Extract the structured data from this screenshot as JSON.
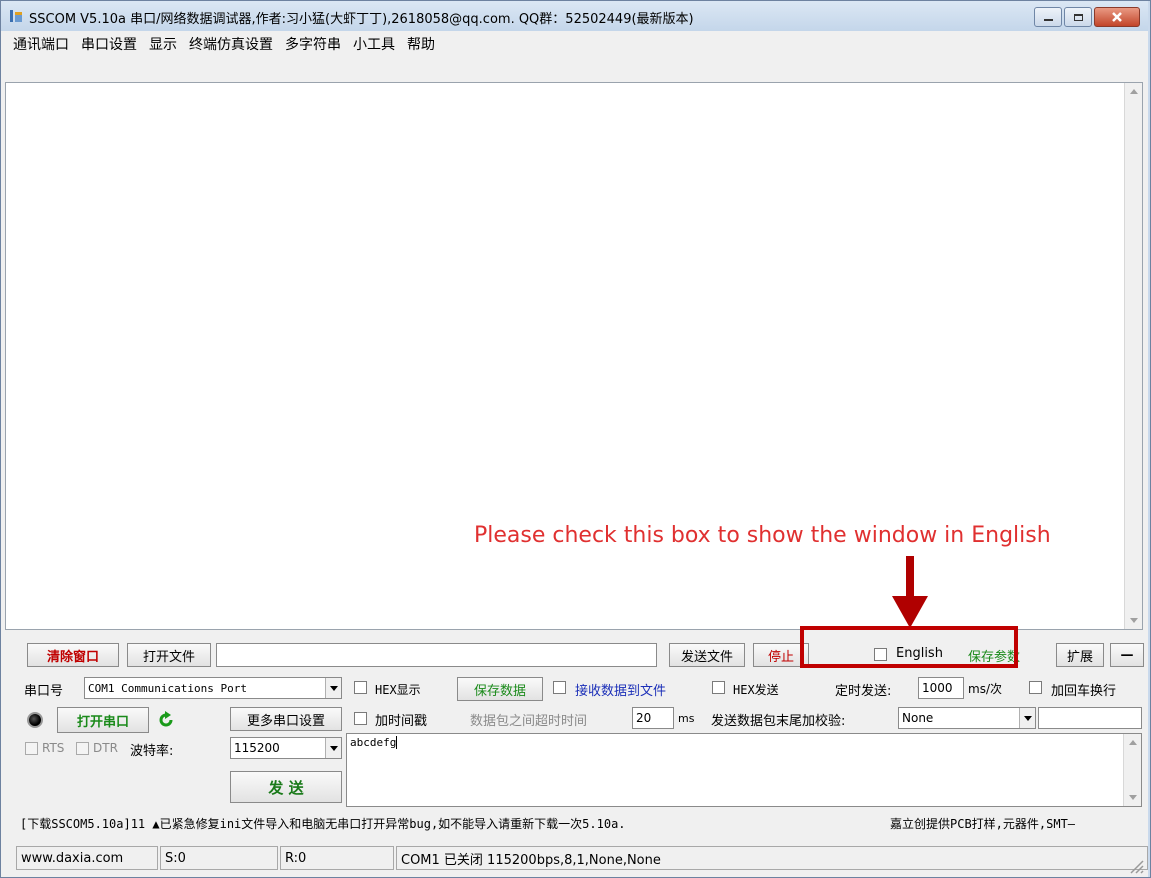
{
  "window": {
    "title": "SSCOM V5.10a 串口/网络数据调试器,作者:习小猛(大虾丁丁),2618058@qq.com. QQ群：52502449(最新版本)"
  },
  "menu": [
    "通讯端口",
    "串口设置",
    "显示",
    "终端仿真设置",
    "多字符串",
    "小工具",
    "帮助"
  ],
  "annotation": {
    "text": "Please check this box to show the window in English",
    "color": "#e03030"
  },
  "toolbar": {
    "clear_window": "清除窗口",
    "open_file": "打开文件",
    "file_path": "",
    "send_file": "发送文件",
    "stop": "停止",
    "english": "English",
    "save_params": "保存参数",
    "expand": "扩展",
    "collapse": "—"
  },
  "port": {
    "label": "串口号",
    "value": "COM1 Communications Port",
    "open_button": "打开串口",
    "more_settings": "更多串口设置",
    "rts": "RTS",
    "dtr": "DTR",
    "baud_label": "波特率:",
    "baud_value": "115200",
    "send_button": "发  送"
  },
  "options": {
    "hex_display": "HEX显示",
    "save_data": "保存数据",
    "recv_to_file": "接收数据到文件",
    "hex_send": "HEX发送",
    "timed_send": "定时发送:",
    "timed_value": "1000",
    "timed_unit": "ms/次",
    "append_newline": "加回车换行",
    "add_timestamp": "加时间戳",
    "packet_timeout": "数据包之间超时时间",
    "timeout_value": "20",
    "timeout_unit": "ms",
    "checksum_label": "发送数据包末尾加校验:",
    "checksum_value": "None",
    "checksum_extra": ""
  },
  "send_text": "abcdefg",
  "ticker": {
    "left": "[下载SSCOM5.10a]11 ▲已紧急修复ini文件导入和电脑无串口打开异常bug,如不能导入请重新下载一次5.10a.",
    "right": "嘉立创提供PCB打样,元器件,SMT—"
  },
  "status": {
    "site": "www.daxia.com",
    "sent": "S:0",
    "received": "R:0",
    "port_state": "COM1 已关闭  115200bps,8,1,None,None"
  }
}
